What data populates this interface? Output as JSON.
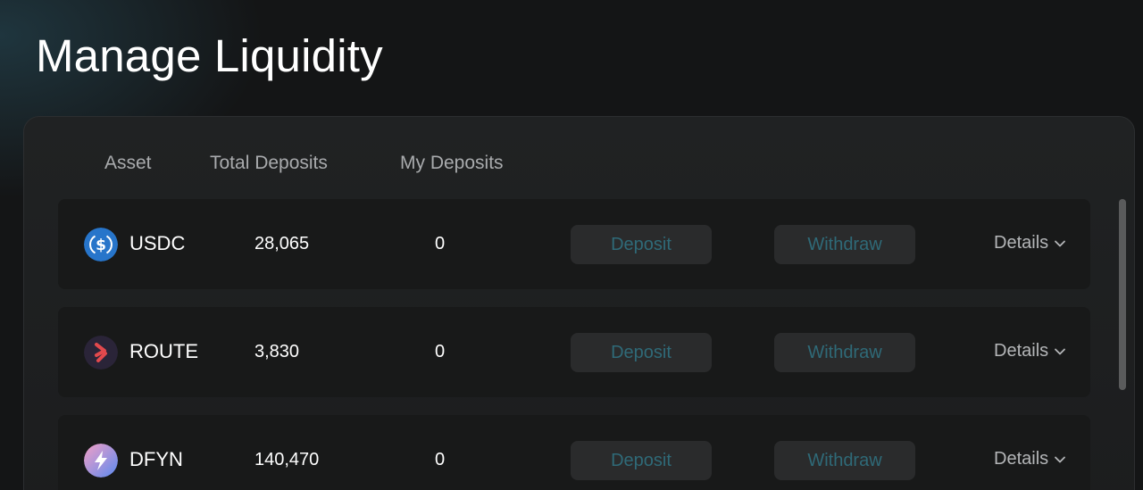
{
  "header": {
    "title": "Manage Liquidity"
  },
  "table": {
    "columns": [
      "Asset",
      "Total Deposits",
      "My Deposits"
    ],
    "rows": [
      {
        "asset": "USDC",
        "icon": "usdc-icon",
        "total_deposits": "28,065",
        "my_deposits": "0",
        "deposit_label": "Deposit",
        "withdraw_label": "Withdraw",
        "details_label": "Details"
      },
      {
        "asset": "ROUTE",
        "icon": "route-icon",
        "total_deposits": "3,830",
        "my_deposits": "0",
        "deposit_label": "Deposit",
        "withdraw_label": "Withdraw",
        "details_label": "Details"
      },
      {
        "asset": "DFYN",
        "icon": "dfyn-icon",
        "total_deposits": "140,470",
        "my_deposits": "0",
        "deposit_label": "Deposit",
        "withdraw_label": "Withdraw",
        "details_label": "Details"
      }
    ]
  },
  "colors": {
    "background": "#141516",
    "panel": "#1e1f20",
    "row": "#181919",
    "button_bg": "#2a2b2c",
    "button_text": "#2f6a78",
    "usdc_blue": "#2775ca",
    "route_red": "#e2494d",
    "dfyn_gradient": [
      "#f4a0c6",
      "#5b8af0"
    ]
  }
}
